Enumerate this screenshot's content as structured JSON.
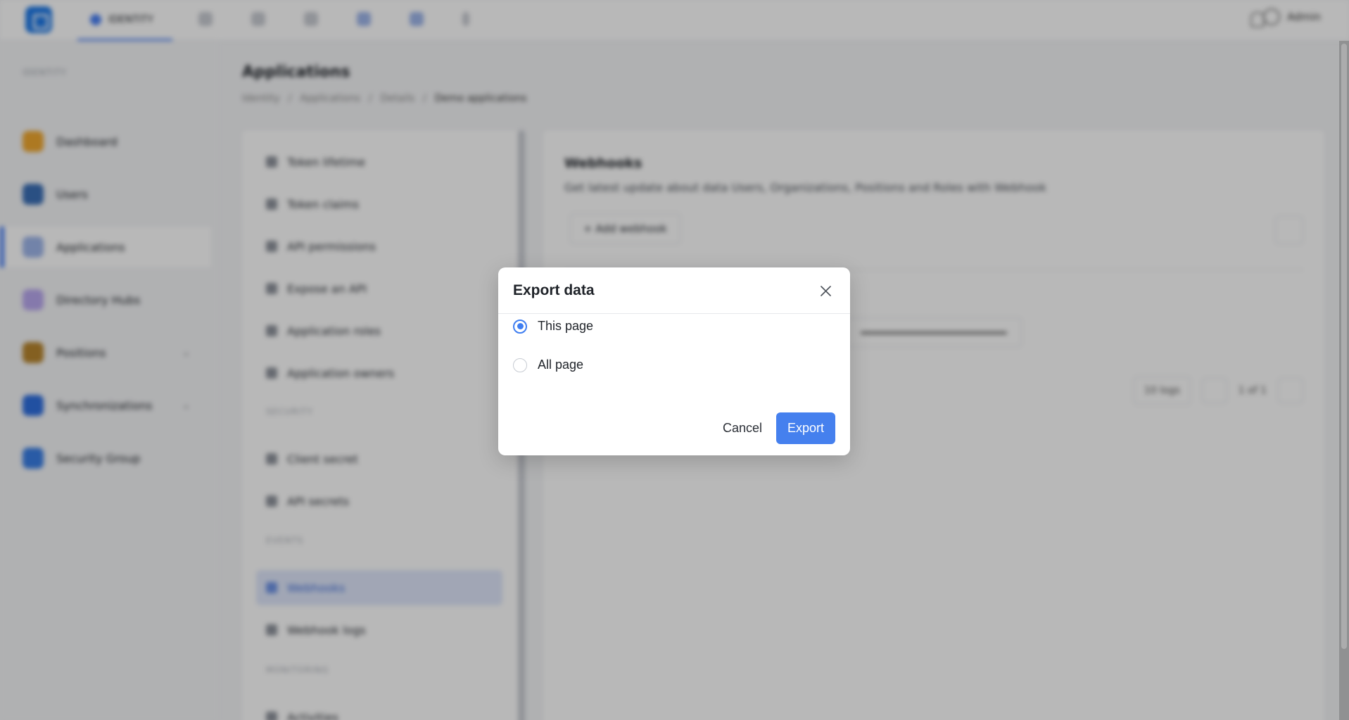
{
  "topbar": {
    "active_tab": "IDENTITY",
    "user_name": "Admin"
  },
  "sidebar": {
    "section_title": "IDENTITY",
    "items": [
      {
        "label": "Dashboard",
        "color": "#f0a830"
      },
      {
        "label": "Users",
        "color": "#3b6fb6"
      },
      {
        "label": "Applications",
        "color": "#4a80f5"
      },
      {
        "label": "Directory Hubs",
        "color": "#7b5be0"
      },
      {
        "label": "Positions",
        "color": "#b8862e"
      },
      {
        "label": "Synchronizations",
        "color": "#2f6fe0"
      },
      {
        "label": "Security Group",
        "color": "#3a7fe6"
      }
    ]
  },
  "content": {
    "title": "Applications",
    "breadcrumb": [
      "Identity",
      "Applications",
      "Details",
      "Demo applications"
    ],
    "subnav": {
      "items_top": [
        "Token lifetime",
        "Token claims",
        "API permissions",
        "Expose an API",
        "Application roles",
        "Application owners"
      ],
      "section_security": "SECURITY",
      "items_security": [
        "Client secret",
        "API secrets"
      ],
      "section_events": "EVENTS",
      "items_events": [
        "Webhooks",
        "Webhook logs"
      ],
      "section_monitoring": "MONITORING",
      "items_monitoring": [
        "Activities"
      ]
    },
    "main": {
      "title": "Webhooks",
      "description": "Get latest update about data Users, Organizations, Positions and Roles with Webhook",
      "add_button": "+ Add webhook",
      "page_size": "10 logs",
      "page_info": "1 of 1"
    }
  },
  "modal": {
    "title": "Export data",
    "options": [
      {
        "label": "This page",
        "checked": true
      },
      {
        "label": "All page",
        "checked": false
      }
    ],
    "cancel_label": "Cancel",
    "export_label": "Export",
    "accent": "#4580ee"
  }
}
